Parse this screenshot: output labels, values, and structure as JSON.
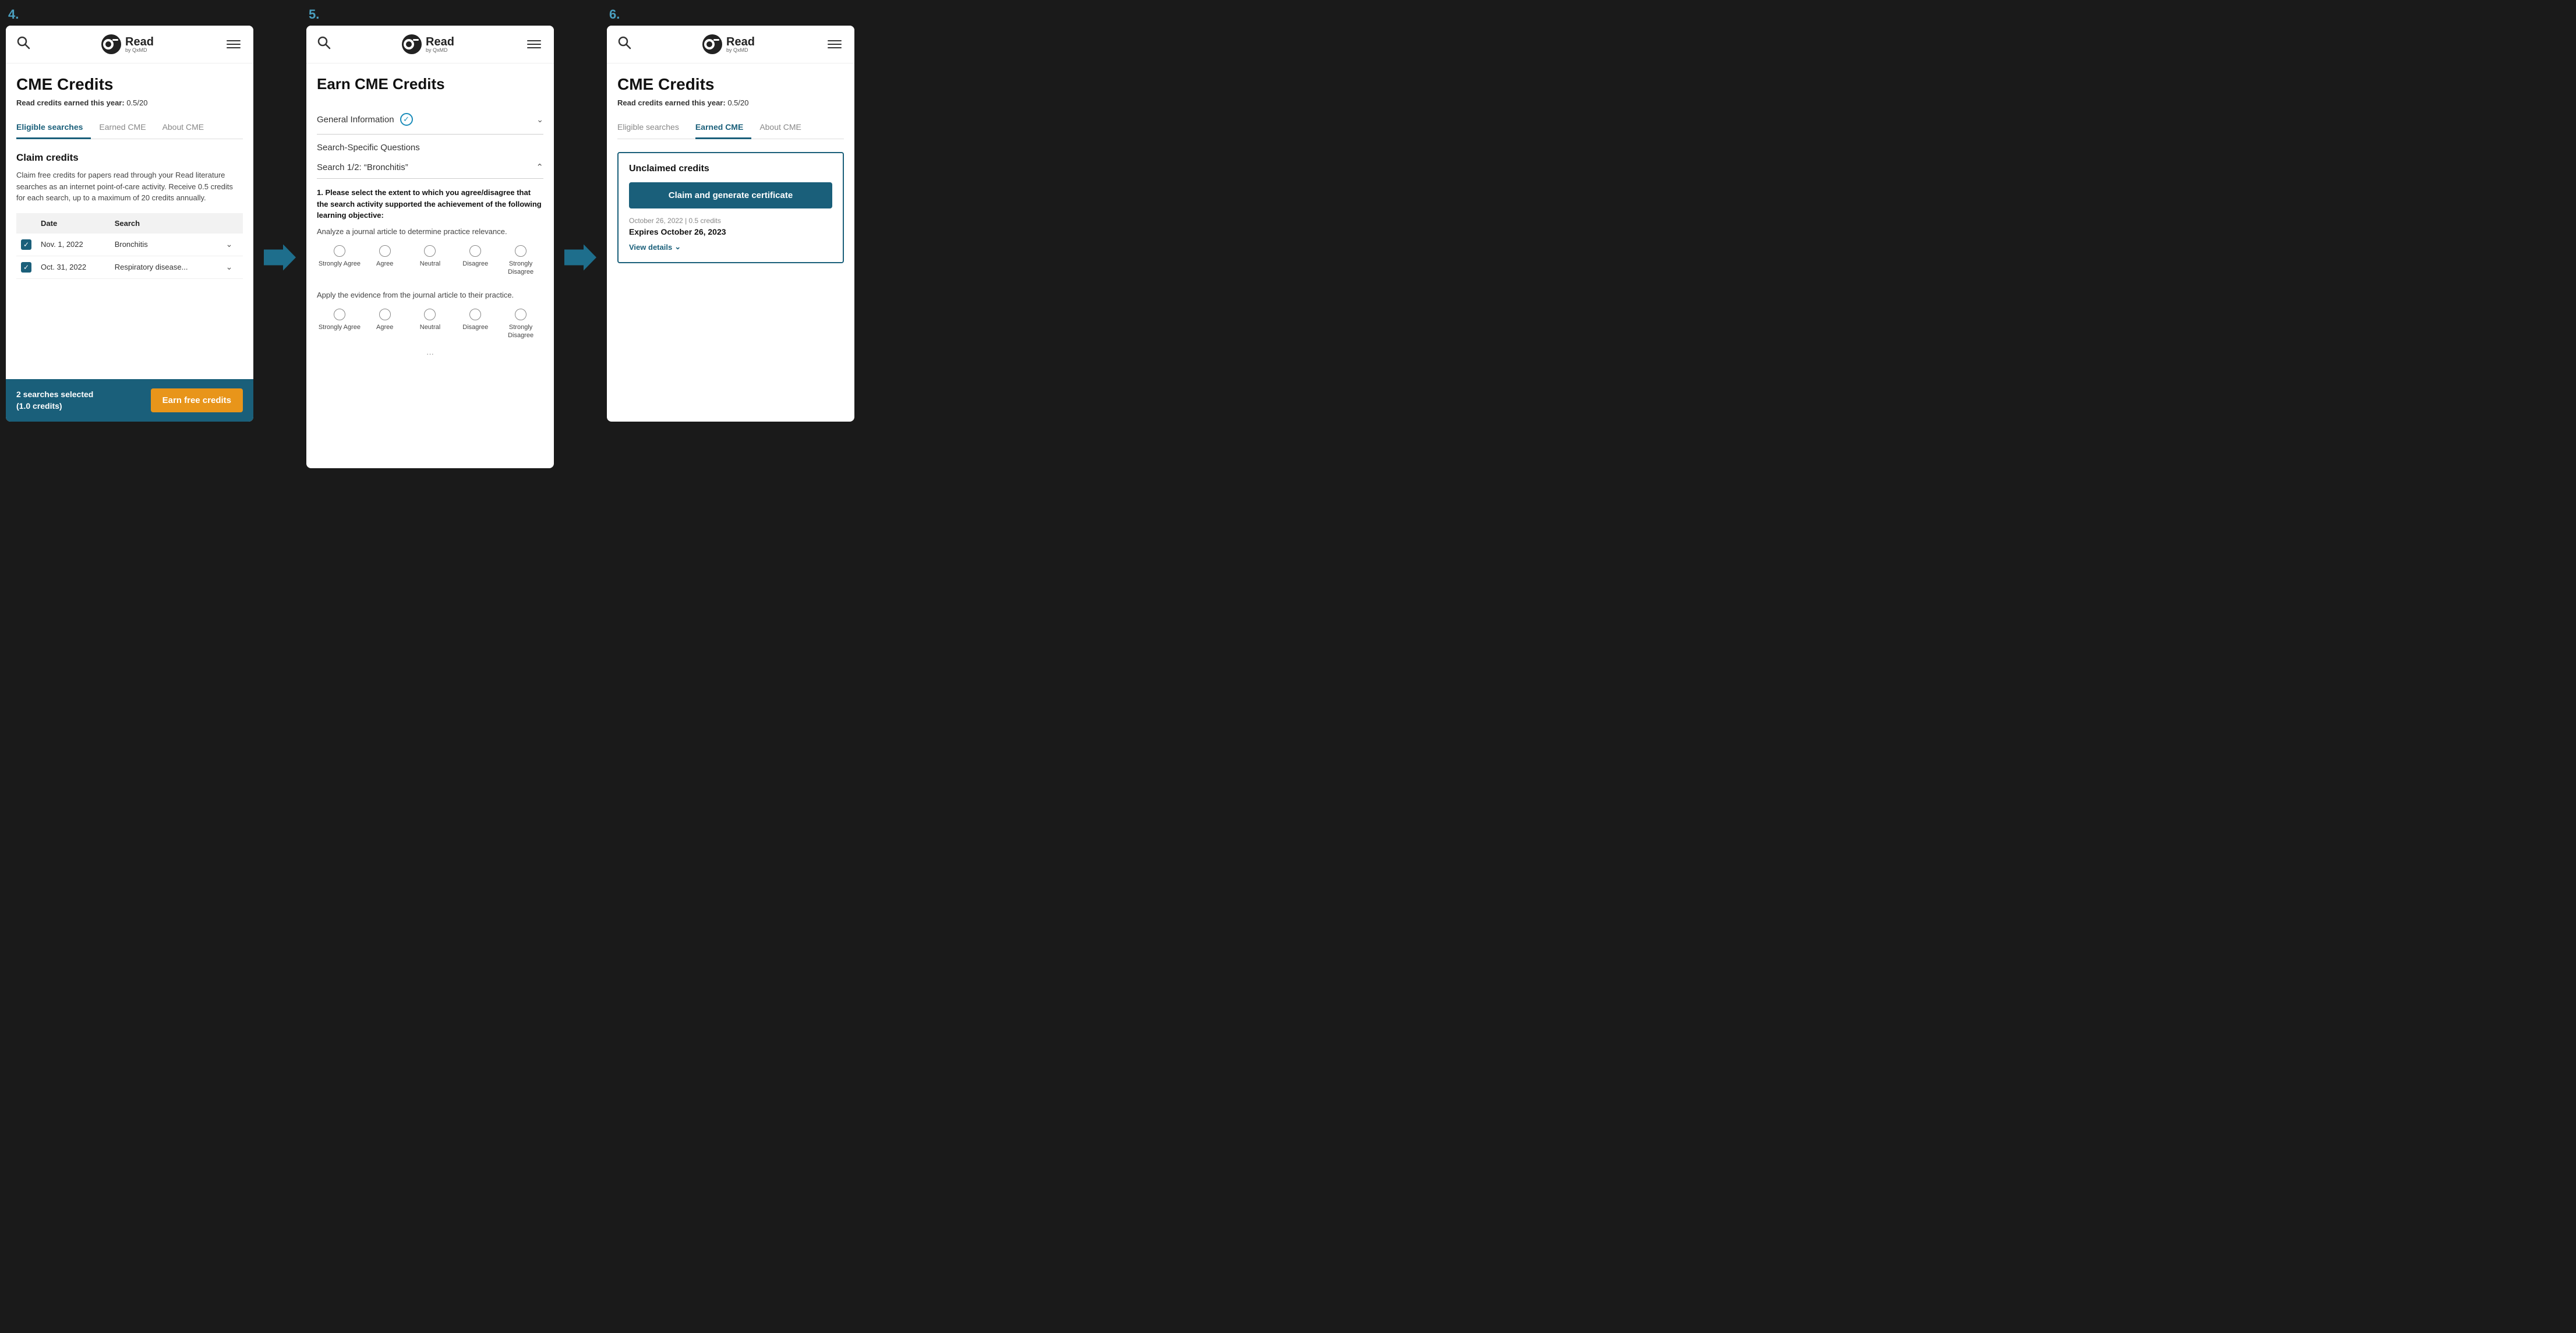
{
  "steps": [
    {
      "number": "4.",
      "header": {
        "search_label": "search",
        "logo_main": "Read",
        "logo_sub": "by QxMD",
        "menu_label": "menu"
      },
      "page_title": "CME Credits",
      "credits_label": "Read credits earned this year:",
      "credits_value": "0.5/20",
      "tabs": [
        {
          "label": "Eligible searches",
          "active": true
        },
        {
          "label": "Earned CME",
          "active": false
        },
        {
          "label": "About CME",
          "active": false
        }
      ],
      "section_title": "Claim credits",
      "section_desc": "Claim free credits for papers read through your Read literature searches as an internet point-of-care activity. Receive 0.5 credits for each search, up to a maximum of 20 credits annually.",
      "table_headers": [
        "Date",
        "Search"
      ],
      "table_rows": [
        {
          "checked": true,
          "date": "Nov. 1, 2022",
          "search": "Bronchitis"
        },
        {
          "checked": true,
          "date": "Oct. 31, 2022",
          "search": "Respiratory disease..."
        }
      ],
      "bottom_bar": {
        "selected_text": "2 searches selected",
        "credits_text": "(1.0 credits)",
        "btn_label": "Earn free credits"
      }
    },
    {
      "number": "5.",
      "header": {
        "search_label": "search",
        "logo_main": "Read",
        "logo_sub": "by QxMD",
        "menu_label": "menu"
      },
      "page_title": "Earn CME Credits",
      "accordion_general": {
        "title": "General Information",
        "completed": true
      },
      "search_specific_title": "Search-Specific Questions",
      "search_accordion": {
        "title": "Search 1/2: “Bronchitis”",
        "expanded": true
      },
      "question1": {
        "text": "1. Please select the extent to which you agree/disagree that the search activity supported the achievement of the following learning objective:",
        "sub": "Analyze a journal article to determine practice relevance.",
        "options": [
          "Strongly Agree",
          "Agree",
          "Neutral",
          "Disagree",
          "Strongly Disagree"
        ]
      },
      "question2": {
        "sub": "Apply the evidence from the journal article to their practice.",
        "options": [
          "Strongly Agree",
          "Agree",
          "Neutral",
          "Disagree",
          "Strongly Disagree"
        ]
      }
    },
    {
      "number": "6.",
      "header": {
        "search_label": "search",
        "logo_main": "Read",
        "logo_sub": "by QxMD",
        "menu_label": "menu"
      },
      "page_title": "CME Credits",
      "credits_label": "Read credits earned this year:",
      "credits_value": "0.5/20",
      "tabs": [
        {
          "label": "Eligible searches",
          "active": false
        },
        {
          "label": "Earned CME",
          "active": true
        },
        {
          "label": "About CME",
          "active": false
        }
      ],
      "unclaimed": {
        "box_title": "Unclaimed credits",
        "claim_btn": "Claim and generate certificate",
        "date_label": "October 26, 2022 | 0.5 credits",
        "expires_label": "Expires October 26, 2023",
        "view_details": "View details"
      }
    }
  ]
}
